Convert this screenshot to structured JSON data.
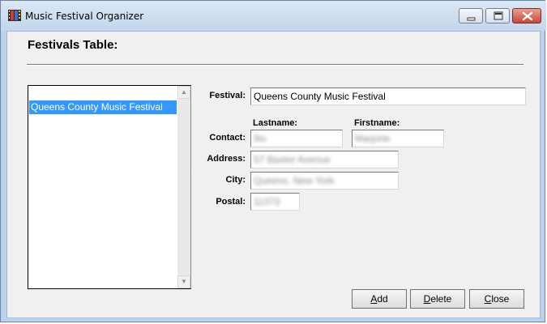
{
  "window": {
    "title": "Music Festival Organizer"
  },
  "page": {
    "heading": "Festivals Table:"
  },
  "festivals_list": {
    "items": [
      "Queens County Music Festival"
    ],
    "selected_index": 0
  },
  "form": {
    "festival_label": "Festival:",
    "festival_value": "Queens County Music Festival",
    "lastname_header": "Lastname:",
    "firstname_header": "Firstname:",
    "contact_label": "Contact:",
    "contact_lastname": "Ilio",
    "contact_firstname": "Marjorie",
    "address_label": "Address:",
    "address_value": "57 Baxter Avenue",
    "city_label": "City:",
    "city_value": "Queens, New York",
    "postal_label": "Postal:",
    "postal_value": "11373"
  },
  "buttons": {
    "add_mnemonic": "A",
    "add_rest": "dd",
    "delete_mnemonic": "D",
    "delete_rest": "elete",
    "close_mnemonic": "C",
    "close_rest": "lose"
  },
  "icons": {
    "app": "film-strip-icon",
    "minimize": "minimize-icon",
    "maximize": "maximize-icon",
    "close": "close-icon",
    "scroll_up": "scroll-up-arrow-icon",
    "scroll_down": "scroll-down-arrow-icon"
  },
  "colors": {
    "selection": "#3399ff",
    "close_button": "#c8483a"
  }
}
